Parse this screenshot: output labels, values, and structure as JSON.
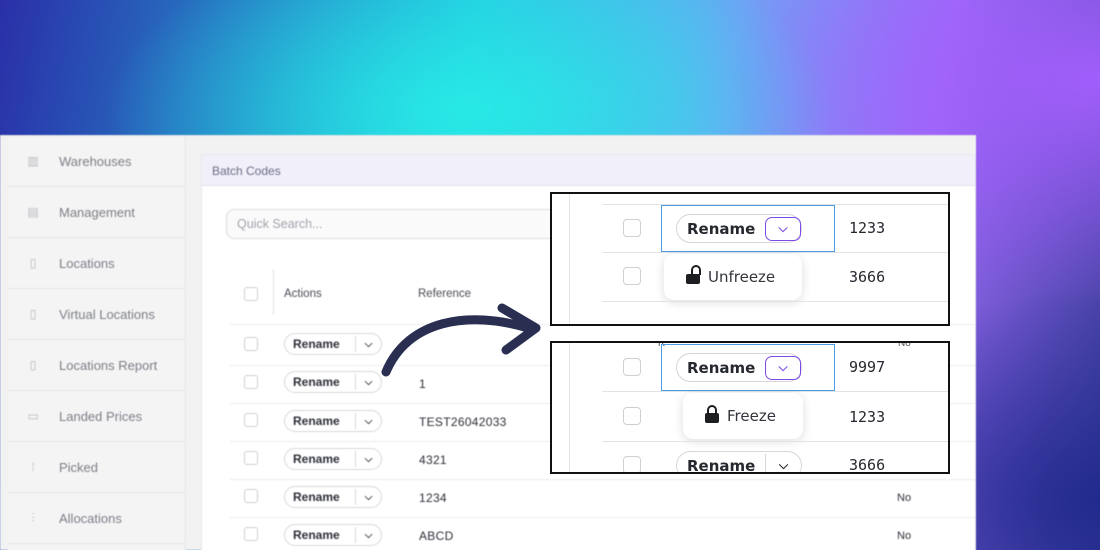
{
  "sidebar": {
    "items": [
      {
        "label": "Warehouses",
        "icon": "warehouse-icon"
      },
      {
        "label": "Management",
        "icon": "document-icon"
      },
      {
        "label": "Locations",
        "icon": "clipboard-icon"
      },
      {
        "label": "Virtual Locations",
        "icon": "clipboard-icon"
      },
      {
        "label": "Locations Report",
        "icon": "clipboard-icon"
      },
      {
        "label": "Landed Prices",
        "icon": "money-icon"
      },
      {
        "label": "Picked",
        "icon": "picked-icon"
      },
      {
        "label": "Allocations",
        "icon": "allocations-icon"
      }
    ]
  },
  "main": {
    "title": "Batch Codes",
    "search_placeholder": "Quick Search...",
    "columns": {
      "actions": "Actions",
      "reference": "Reference"
    },
    "action_label": "Rename",
    "rows": [
      {
        "reference": "",
        "status": ""
      },
      {
        "reference": "1",
        "status": ""
      },
      {
        "reference": "TEST26042033",
        "status": ""
      },
      {
        "reference": "4321",
        "status": ""
      },
      {
        "reference": "1234",
        "status": "No"
      },
      {
        "reference": "ABCD",
        "status": "No"
      }
    ]
  },
  "callout_top": {
    "rows": [
      {
        "action": "Rename",
        "value": "1233"
      },
      {
        "value": "3666"
      }
    ],
    "menu_item": "Unfreeze",
    "menu_icon": "unlock-icon"
  },
  "callout_bottom": {
    "rows": [
      {
        "action": "Rename",
        "value": "9997"
      },
      {
        "value": "1233"
      },
      {
        "action": "Rename",
        "value": "3666"
      }
    ],
    "menu_item": "Freeze",
    "menu_icon": "lock-icon",
    "partial_header_left": "R",
    "partial_header_right": "No"
  },
  "colors": {
    "accent": "#7c4be6",
    "selection": "#4a9ee8",
    "arrow": "#2a2f52"
  }
}
